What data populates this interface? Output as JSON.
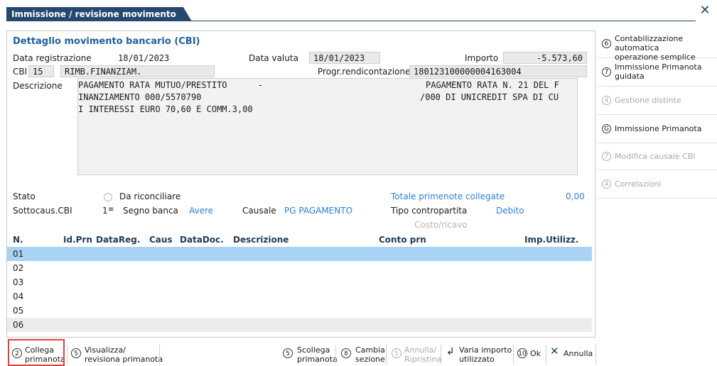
{
  "window": {
    "title": "Immissione / revisione movimento",
    "close_icon": "close-icon"
  },
  "detail": {
    "heading": "Dettaglio movimento bancario (CBI)",
    "data_registrazione_label": "Data registrazione",
    "data_registrazione": "18/01/2023",
    "data_valuta_label": "Data valuta",
    "data_valuta": "18/01/2023",
    "importo_label": "Importo",
    "importo": "-5.573,60",
    "cbi_label": "CBI",
    "cbi_code": "15",
    "cbi_desc": "RIMB.FINANZIAM.",
    "progr_label": "Progr.rendicontazione",
    "progr_value": "180123100000004163004",
    "descrizione_label": "Descrizione",
    "descrizione": {
      "l1a": "PAGAMENTO RATA MUTUO/PRESTITO      -",
      "l1b": "PAGAMENTO RATA N. 21 DEL F",
      "l2a": "INANZIAMENTO 000/5570790",
      "l2b": "/000 DI UNICREDIT SPA DI CU",
      "l3a": "I INTERESSI EURO 70,60 E COMM.3,00"
    }
  },
  "status": {
    "stato_label": "Stato",
    "stato_value": "Da riconciliare",
    "totale_label": "Totale primenote collegate",
    "totale_value": "0,00",
    "sottocaus_label": "Sottocaus.CBI",
    "sottocaus_value": "1",
    "segno_label": "Segno banca",
    "segno_value": "Avere",
    "causale_label": "Causale",
    "causale_value": "PG PAGAMENTO",
    "tipo_label": "Tipo contropartita",
    "tipo_value": "Debito",
    "costo_label": "Costo/ricavo"
  },
  "grid": {
    "columns": [
      "N.",
      "Id.Prn",
      "DataReg.",
      "Caus",
      "DataDoc.",
      "Descrizione",
      "Conto prn",
      "Imp.Utilizz."
    ],
    "rows": [
      "01",
      "02",
      "03",
      "04",
      "05",
      "06"
    ]
  },
  "sidebar": {
    "items": [
      {
        "num": "6",
        "label1": "Contabilizzazione automatica",
        "label2": "operazione semplice"
      },
      {
        "num": "7",
        "label1": "Immissione Primanota",
        "label2": "guidata"
      },
      {
        "num": "4",
        "label1": "Gestione distinte",
        "label2": ""
      },
      {
        "num": "G",
        "label1": "Immissione Primanota",
        "label2": ""
      },
      {
        "num": "7",
        "label1": "Modifica causale CBI",
        "label2": ""
      },
      {
        "num": "4",
        "label1": "Correlazioni",
        "label2": ""
      }
    ]
  },
  "toolbar": {
    "collega": {
      "num": "2",
      "l1": "Collega",
      "l2": "primanota"
    },
    "visualizza": {
      "num": "5",
      "l1": "Visualizza/",
      "l2": "revisiona primanota"
    },
    "scollega": {
      "num": "5",
      "l1": "Scollega",
      "l2": "primanota"
    },
    "cambia": {
      "num": "8",
      "l1": "Cambia",
      "l2": "sezione"
    },
    "annulla_rip": {
      "num": "5",
      "l1": "Annulla/",
      "l2": "Ripristina"
    },
    "varia": {
      "l1": "Varia importo",
      "l2": "utilizzato"
    },
    "ok": {
      "num": "10",
      "label": "Ok"
    },
    "annulla": {
      "label": "Annulla"
    }
  },
  "colors": {
    "title_bg": "#24486e",
    "selected_row": "#a9d3f5",
    "accent_blue": "#2f7ed8",
    "highlight_border": "#e0403a"
  }
}
